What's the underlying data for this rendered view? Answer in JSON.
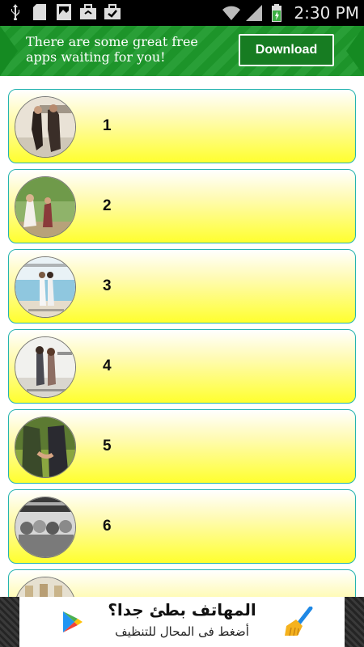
{
  "status_bar": {
    "time": "2:30 PM",
    "left_icons": [
      "usb-icon",
      "sd-card-icon",
      "image-icon",
      "briefcase-icon",
      "briefcase-check-icon"
    ],
    "right_icons": [
      "wifi-icon",
      "signal-icon",
      "battery-icon"
    ]
  },
  "banner": {
    "message": "There are some great free apps waiting for you!",
    "button_label": "Download",
    "colors": {
      "background": "#1e9a2c",
      "button": "#177c22"
    }
  },
  "list": {
    "items": [
      {
        "label": "1",
        "thumbnail_icon": "couple-photo-icon"
      },
      {
        "label": "2",
        "thumbnail_icon": "children-photo-icon"
      },
      {
        "label": "3",
        "thumbnail_icon": "beach-couple-photo-icon"
      },
      {
        "label": "4",
        "thumbnail_icon": "couple-walking-photo-icon"
      },
      {
        "label": "5",
        "thumbnail_icon": "holding-hands-photo-icon"
      },
      {
        "label": "6",
        "thumbnail_icon": "friends-photo-icon"
      },
      {
        "label": "",
        "thumbnail_icon": "photo-icon"
      }
    ],
    "colors": {
      "border": "#24b3b0",
      "gradient_bottom": "#ffff2e"
    }
  },
  "bottom_ad": {
    "title": "المهاتف بطئ جدا؟",
    "subtitle": "أضغط فى المحال للتنظيف",
    "icons": [
      "play-store-icon",
      "broom-icon"
    ]
  }
}
